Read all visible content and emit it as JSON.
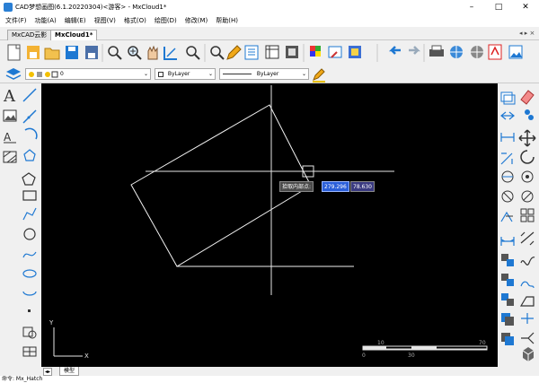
{
  "window": {
    "title": "CAD梦想画图(6.1.20220304)<游客> - MxCloud1*"
  },
  "menu": [
    "文件(F)",
    "功能(A)",
    "编辑(E)",
    "视图(V)",
    "格式(O)",
    "绘图(D)",
    "修改(M)",
    "帮助(H)"
  ],
  "tabs": [
    {
      "label": "MxCAD云影"
    },
    {
      "label": "MxCloud1*"
    }
  ],
  "tab_controls": "◂ ▸ ×",
  "layer": {
    "value": "0"
  },
  "color": {
    "value": "ByLayer"
  },
  "linetype": {
    "value": "ByLayer"
  },
  "tooltip": {
    "label": "拾取内部点:",
    "x_value": "279.296",
    "y_value": "78.630"
  },
  "scale_bar": {
    "ticks": [
      "0",
      "10",
      "30",
      "70"
    ]
  },
  "axis": {
    "y": "Y",
    "x": "X"
  },
  "model_tab": "模型",
  "command": "命令:  Mx_Hatch",
  "colors": {
    "canvas": "#000000",
    "accent": "#1e78d2",
    "highlight": "#2b5fd9"
  }
}
